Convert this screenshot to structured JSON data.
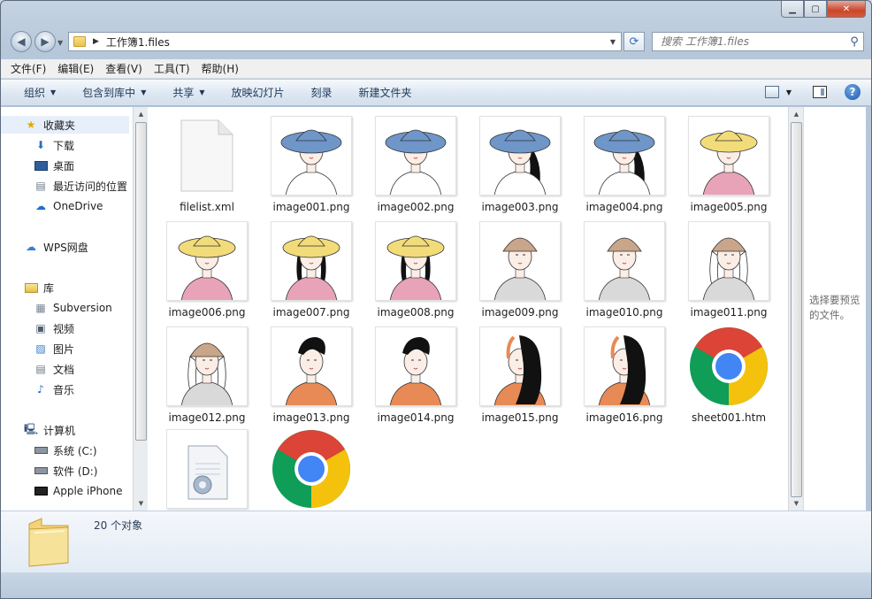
{
  "address": {
    "path": "工作簿1.files",
    "search_placeholder": "搜索 工作簿1.files"
  },
  "menu": [
    "文件(F)",
    "编辑(E)",
    "查看(V)",
    "工具(T)",
    "帮助(H)"
  ],
  "commands": {
    "organize": "组织",
    "include_in_library": "包含到库中",
    "share": "共享",
    "slideshow": "放映幻灯片",
    "burn": "刻录",
    "new_folder": "新建文件夹"
  },
  "nav": {
    "favorites": "收藏夹",
    "downloads": "下载",
    "desktop": "桌面",
    "recent": "最近访问的位置",
    "onedrive": "OneDrive",
    "wps": "WPS网盘",
    "libraries": "库",
    "subversion": "Subversion",
    "videos": "视频",
    "pictures": "图片",
    "documents": "文档",
    "music": "音乐",
    "computer": "计算机",
    "drive_c": "系统 (C:)",
    "drive_d": "软件 (D:)",
    "iphone": "Apple iPhone"
  },
  "files": [
    {
      "name": "filelist.xml",
      "kind": "xml"
    },
    {
      "name": "image001.png",
      "kind": "blue-hat"
    },
    {
      "name": "image002.png",
      "kind": "blue-hat"
    },
    {
      "name": "image003.png",
      "kind": "blue-hat-dark"
    },
    {
      "name": "image004.png",
      "kind": "blue-hat-dark"
    },
    {
      "name": "image005.png",
      "kind": "yellow-hat"
    },
    {
      "name": "image006.png",
      "kind": "yellow-hat"
    },
    {
      "name": "image007.png",
      "kind": "yellow-hat-braid"
    },
    {
      "name": "image008.png",
      "kind": "yellow-hat-braid"
    },
    {
      "name": "image009.png",
      "kind": "beanie"
    },
    {
      "name": "image010.png",
      "kind": "beanie"
    },
    {
      "name": "image011.png",
      "kind": "beanie-hair"
    },
    {
      "name": "image012.png",
      "kind": "beanie-hair"
    },
    {
      "name": "image013.png",
      "kind": "orange-boy"
    },
    {
      "name": "image014.png",
      "kind": "orange-boy"
    },
    {
      "name": "image015.png",
      "kind": "long-hair"
    },
    {
      "name": "image016.png",
      "kind": "long-hair"
    },
    {
      "name": "sheet001.htm",
      "kind": "chrome"
    },
    {
      "name": "",
      "kind": "config"
    },
    {
      "name": "",
      "kind": "chrome"
    }
  ],
  "preview_text": "选择要预览的文件。",
  "status": "20 个对象",
  "colors": {
    "blue_hat": "#6f96c8",
    "yellow_hat": "#f2dc7a",
    "pink_shirt": "#e9a3b8",
    "orange_shirt": "#e88a55",
    "chrome_red": "#db4437",
    "chrome_yellow": "#f4c20d",
    "chrome_green": "#0f9d58",
    "chrome_blue": "#4285f4"
  }
}
